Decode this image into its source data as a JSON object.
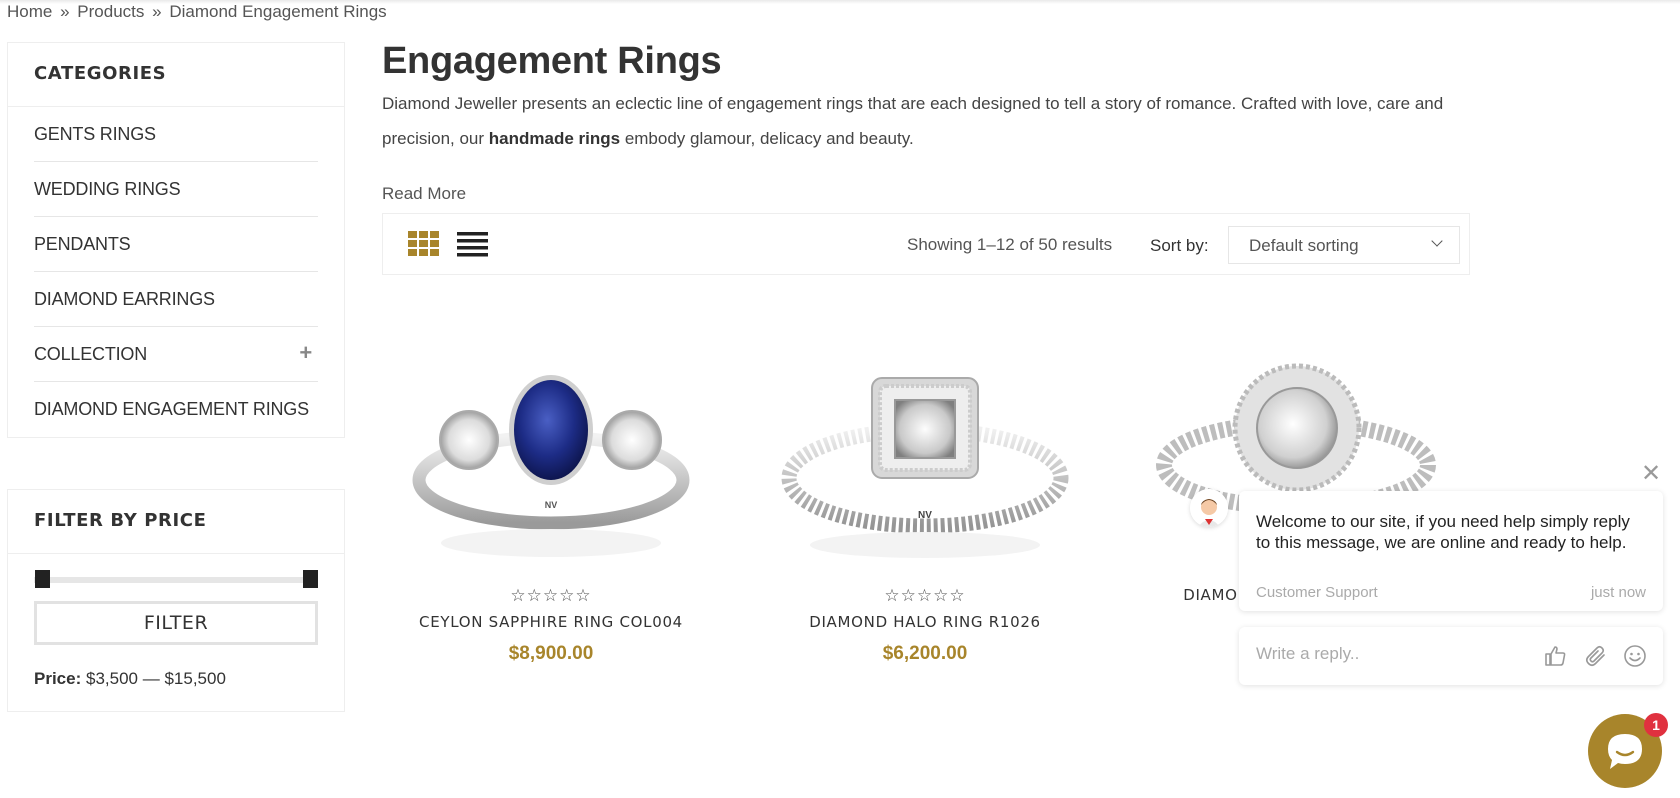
{
  "breadcrumb": {
    "home": "Home",
    "separator": "»",
    "products": "Products",
    "current": "Diamond Engagement Rings"
  },
  "sidebar": {
    "categories_title": "CATEGORIES",
    "categories": [
      {
        "label": "GENTS RINGS"
      },
      {
        "label": "WEDDING RINGS"
      },
      {
        "label": "PENDANTS"
      },
      {
        "label": "DIAMOND EARRINGS"
      },
      {
        "label": "COLLECTION",
        "expand_icon": "plus-icon"
      },
      {
        "label": "DIAMOND ENGAGEMENT RINGS"
      }
    ],
    "filter_title": "FILTER BY PRICE",
    "filter_button": "FILTER",
    "price_label": "Price:",
    "price_min": "$3,500",
    "price_dash": "—",
    "price_max": "$15,500"
  },
  "main": {
    "title": "Engagement Rings",
    "desc_part1": "Diamond Jeweller presents an eclectic line of engagement rings that are each designed to tell a story of romance. Crafted with love, care and precision, our ",
    "desc_bold": "handmade rings",
    "desc_part2": " embody glamour, delicacy and beauty.",
    "read_more": "Read More"
  },
  "toolbar": {
    "grid_icon": "grid-view-icon",
    "list_icon": "list-view-icon",
    "result_count": "Showing 1–12 of 50 results",
    "sort_label": "Sort by:",
    "sort_value": "Default sorting"
  },
  "products": [
    {
      "name": "CEYLON SAPPHIRE RING COL004",
      "price": "$8,900.00",
      "stars": "☆☆☆☆☆"
    },
    {
      "name": "DIAMOND HALO RING R1026",
      "price": "$6,200.00",
      "stars": "☆☆☆☆☆"
    },
    {
      "name": "DIAMOND HALO RING R1065",
      "price": "",
      "stars": ""
    }
  ],
  "chat": {
    "close": "✕",
    "message": "Welcome to our site, if you need help simply reply to this message, we are online and ready to help.",
    "from": "Customer Support",
    "time": "just now",
    "reply_placeholder": "Write a reply..",
    "badge": "1"
  },
  "colors": {
    "accent_gold": "#a8852b",
    "badge_red": "#e0313f"
  }
}
